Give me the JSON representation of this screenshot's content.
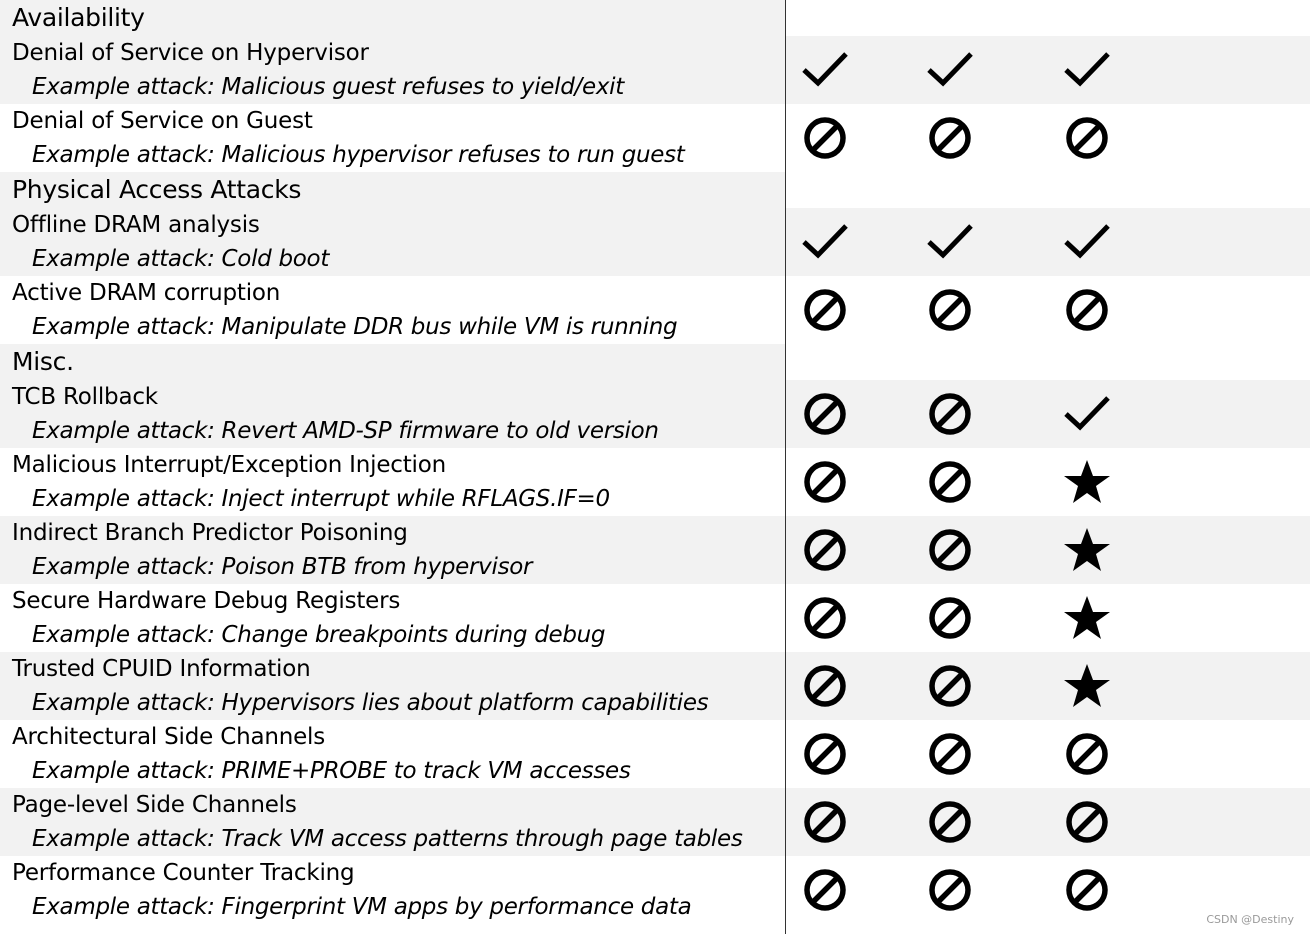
{
  "rows": [
    {
      "kind": "section",
      "label": "Availability"
    },
    {
      "kind": "item",
      "title": "Denial of Service on Hypervisor",
      "example": "Example attack: Malicious guest refuses to yield/exit",
      "marks": [
        "check",
        "check",
        "check"
      ]
    },
    {
      "kind": "item",
      "title": "Denial of Service on Guest",
      "example": "Example attack: Malicious hypervisor refuses to run guest",
      "marks": [
        "none",
        "none",
        "none"
      ]
    },
    {
      "kind": "section",
      "label": "Physical Access Attacks"
    },
    {
      "kind": "item",
      "title": "Offline DRAM analysis",
      "example": "Example attack: Cold boot",
      "marks": [
        "check",
        "check",
        "check"
      ]
    },
    {
      "kind": "item",
      "title": "Active DRAM corruption",
      "example": "Example attack: Manipulate DDR bus while VM is running",
      "marks": [
        "none",
        "none",
        "none"
      ]
    },
    {
      "kind": "section",
      "label": "Misc."
    },
    {
      "kind": "item",
      "title": "TCB Rollback",
      "example": "Example attack: Revert AMD-SP firmware to old version",
      "marks": [
        "none",
        "none",
        "check"
      ]
    },
    {
      "kind": "item",
      "title": "Malicious Interrupt/Exception Injection",
      "example": "Example attack: Inject interrupt while RFLAGS.IF=0",
      "marks": [
        "none",
        "none",
        "star"
      ]
    },
    {
      "kind": "item",
      "title": "Indirect Branch Predictor Poisoning",
      "example": "Example attack: Poison BTB from hypervisor",
      "marks": [
        "none",
        "none",
        "star"
      ]
    },
    {
      "kind": "item",
      "title": "Secure Hardware Debug Registers",
      "example": "Example attack: Change breakpoints during debug",
      "marks": [
        "none",
        "none",
        "star"
      ]
    },
    {
      "kind": "item",
      "title": "Trusted CPUID Information",
      "example": "Example attack: Hypervisors lies about platform capabilities",
      "marks": [
        "none",
        "none",
        "star"
      ]
    },
    {
      "kind": "item",
      "title": "Architectural Side Channels",
      "example": "Example attack: PRIME+PROBE to track VM accesses",
      "marks": [
        "none",
        "none",
        "none"
      ]
    },
    {
      "kind": "item",
      "title": "Page-level Side Channels",
      "example": "Example attack: Track VM access patterns through page tables",
      "marks": [
        "none",
        "none",
        "none"
      ]
    },
    {
      "kind": "item",
      "title": "Performance Counter Tracking",
      "example": "Example attack: Fingerprint VM apps by performance data",
      "marks": [
        "none",
        "none",
        "none"
      ]
    }
  ],
  "mark_icons": {
    "check": "check-icon",
    "none": "prohibited-icon",
    "star": "star-icon"
  },
  "colors": {
    "row_shade": "#f2f2f2",
    "row_white": "#ffffff",
    "text": "#000000",
    "divider": "#333333"
  },
  "watermark": "CSDN @Destiny"
}
